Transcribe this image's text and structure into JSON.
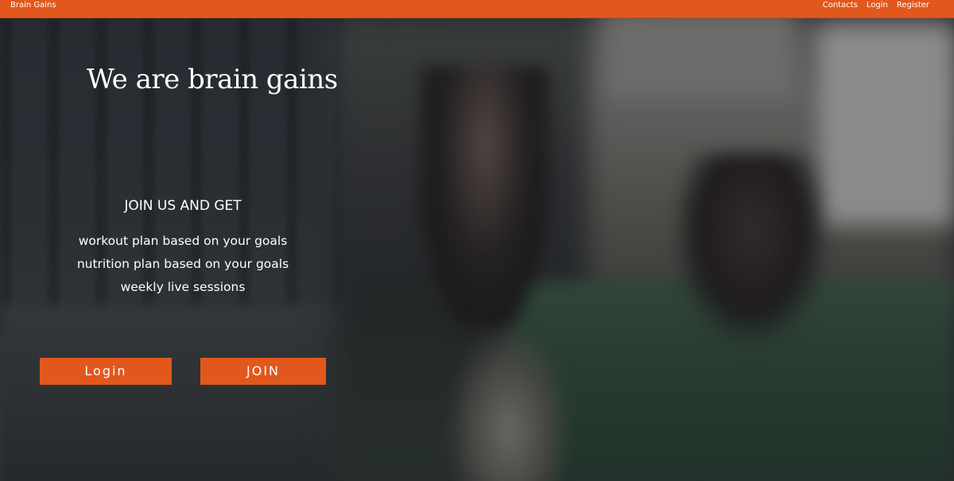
{
  "navbar": {
    "brand": "Brain Gains",
    "links": [
      "Contacts",
      "Login",
      "Register"
    ],
    "color": "#e2581c"
  },
  "hero": {
    "title": "We are brain gains",
    "subheading": "JOIN US AND GET",
    "benefits": [
      "workout plan based on your goals",
      "nutrition plan based on your goals",
      "weekly live sessions"
    ],
    "buttons": {
      "login": "Login",
      "join": "JOIN"
    },
    "accent": "#e2581c"
  }
}
